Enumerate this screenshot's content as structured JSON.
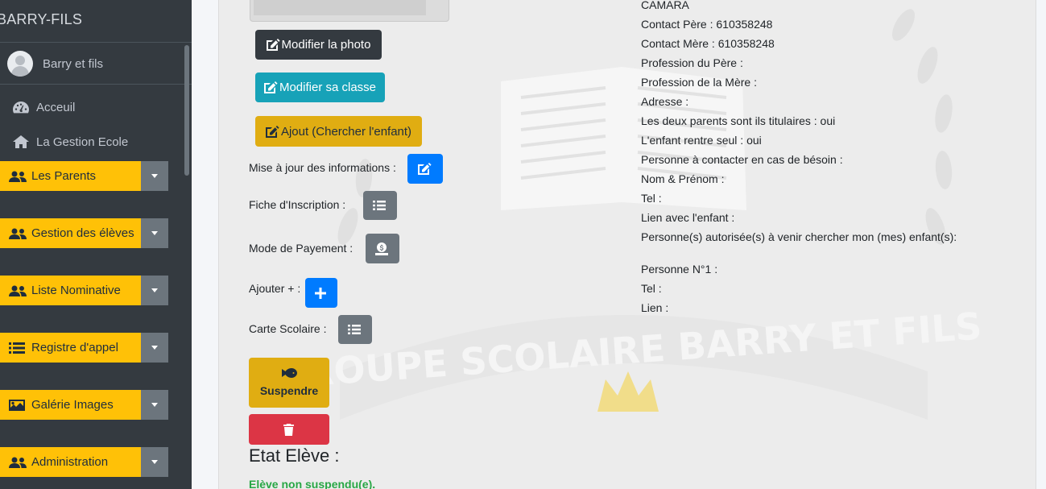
{
  "sidebar": {
    "brand": "BARRY-FILS",
    "user": "Barry et fils",
    "links": [
      {
        "label": "Acceuil",
        "icon": "dashboard-icon"
      },
      {
        "label": "La Gestion Ecole",
        "icon": "home-icon"
      }
    ],
    "dropdowns": [
      {
        "label": "Les Parents",
        "icon": "users-icon"
      },
      {
        "label": "Gestion des élèves",
        "icon": "users-icon"
      },
      {
        "label": "Liste Nominative",
        "icon": "users-icon"
      },
      {
        "label": "Registre d'appel",
        "icon": "list-icon"
      },
      {
        "label": "Galérie Images",
        "icon": "image-icon"
      },
      {
        "label": "Administration",
        "icon": "users-icon"
      }
    ]
  },
  "actions": {
    "modifier_photo": "Modifier la photo",
    "modifier_classe": "Modifier sa classe",
    "ajout": "Ajout (Chercher l'enfant)",
    "mise_a_jour": "Mise à jour des informations :",
    "fiche": "Fiche d'Inscription :",
    "payement": "Mode de Payement :",
    "ajouter": "Ajouter + :",
    "carte": "Carte Scolaire :",
    "suspendre": "Suspendre"
  },
  "etat": {
    "title": "Etat Elève :",
    "status": "Elève non suspendu(e)."
  },
  "info": {
    "line1": "CAMARA",
    "line2": "Contact Père : 610358248",
    "line3": "Contact Mère : 610358248",
    "line4": "Profession du Père :",
    "line5": "Profession de la Mère :",
    "line6": "Adresse :",
    "line7": "Les deux parents sont ils titulaires : oui",
    "line8": "L'enfant rentre seul : oui",
    "line9": "Personne à contacter en cas de bésoin :",
    "line10": "Nom & Prénom :",
    "line11": "Tel :",
    "line12": "Lien avec l'enfant :",
    "line13": "Personne(s) autorisée(s) à venir chercher mon (mes) enfant(s):",
    "line14": "Personne N°1 :",
    "line15": "Tel :",
    "line16": "Lien :"
  },
  "watermark": "GROUPE SCOLAIRE BARRY ET FILS",
  "colors": {
    "sidebar": "#343a40",
    "warning": "#ffc107",
    "info": "#17a2b8",
    "primary": "#007bff",
    "danger": "#dc3545",
    "success": "#28a745"
  }
}
